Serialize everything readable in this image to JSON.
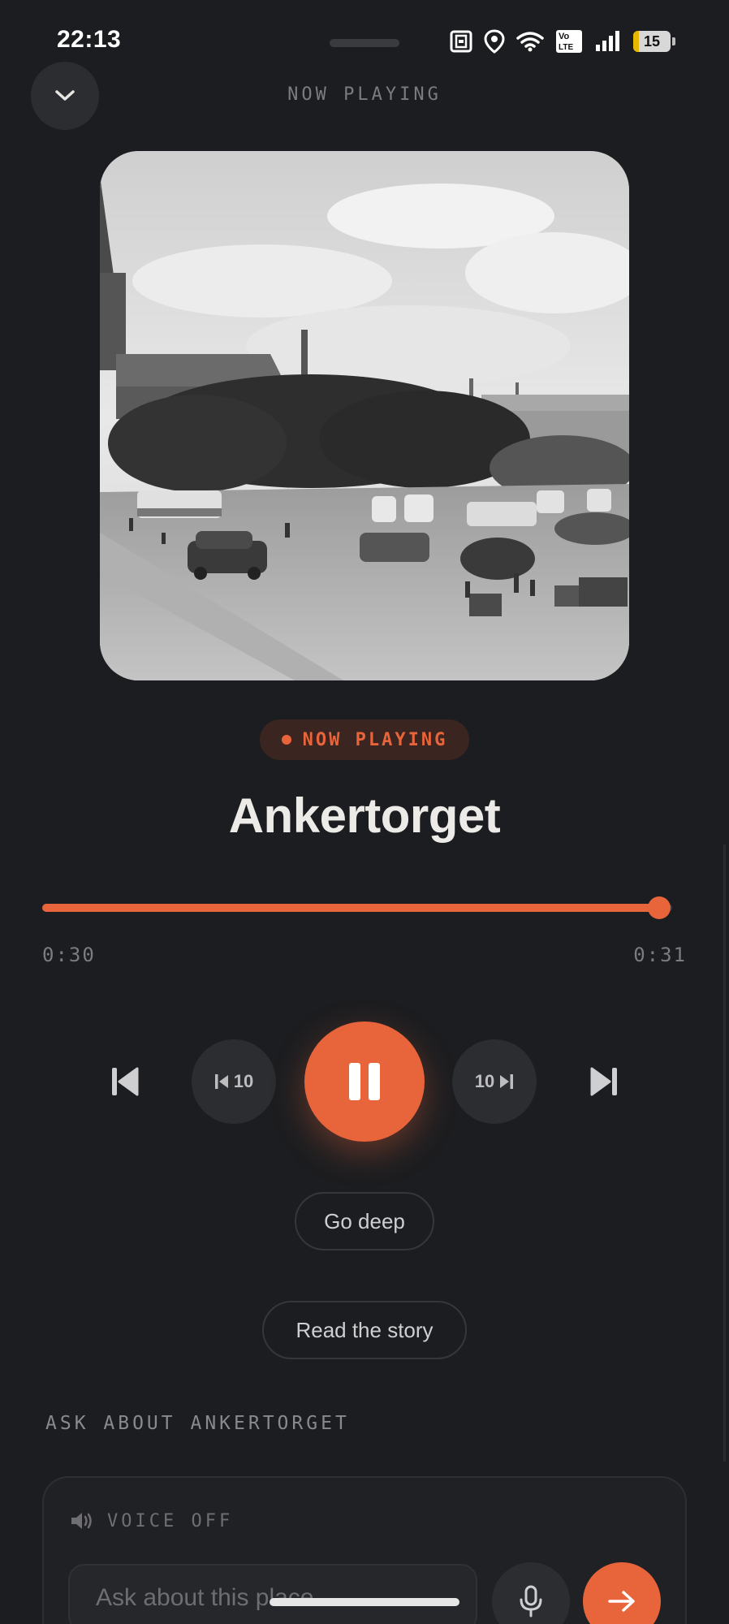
{
  "status_bar": {
    "time": "22:13",
    "battery_level": "15",
    "icons": [
      "nfc-icon",
      "location-icon",
      "wifi-icon",
      "volte-icon",
      "signal-icon",
      "battery-icon"
    ],
    "volte_label": "Vo\nLTE"
  },
  "header": {
    "title": "NOW PLAYING",
    "collapse_icon": "chevron-down-icon"
  },
  "track": {
    "badge": "NOW PLAYING",
    "title": "Ankertorget",
    "elapsed": "0:30",
    "duration": "0:31",
    "progress_fraction": 0.98
  },
  "controls": {
    "previous_icon": "skip-previous-icon",
    "rewind_label": "10",
    "rewind_icon": "skip-back-icon",
    "play_state_icon": "pause-icon",
    "forward_label": "10",
    "forward_icon": "skip-forward-icon",
    "next_icon": "skip-next-icon"
  },
  "actions": {
    "go_deep": "Go deep",
    "read_story": "Read the story"
  },
  "ask": {
    "heading": "ASK ABOUT ANKERTORGET",
    "voice_status": "VOICE OFF",
    "input_placeholder": "Ask about this place...",
    "mic_icon": "microphone-icon",
    "send_icon": "arrow-right-icon"
  },
  "colors": {
    "accent": "#e8643a",
    "background": "#1c1d20",
    "surface": "#2c2d31"
  }
}
